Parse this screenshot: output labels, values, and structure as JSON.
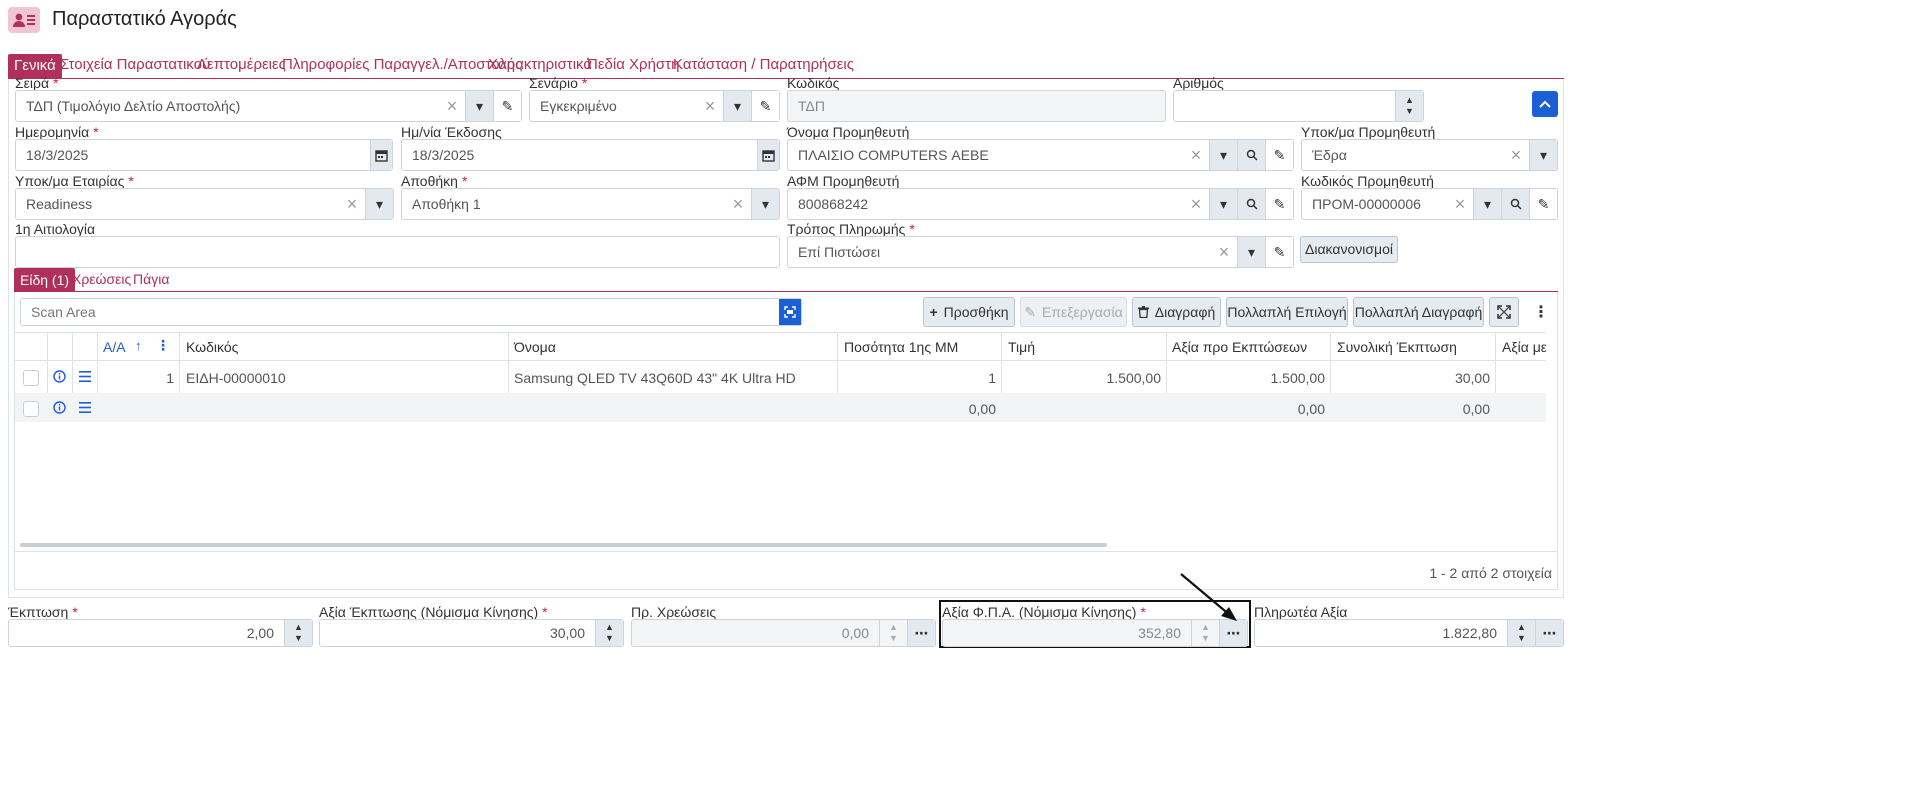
{
  "page": {
    "title": "Παραστατικό Αγοράς"
  },
  "tabs": [
    "Γενικά",
    "Στοιχεία Παραστατικού",
    "Λεπτομέρειες",
    "Πληροφορίες Παραγγελ./Αποστολής",
    "Χαρακτηριστικά",
    "Πεδία Χρήστη",
    "Κατάσταση / Παρατηρήσεις"
  ],
  "form": {
    "series": {
      "label": "Σειρά",
      "value": "ΤΔΠ (Τιμολόγιο Δελτίο Αποστολής)"
    },
    "scenario": {
      "label": "Σενάριο",
      "value": "Εγκεκριμένο"
    },
    "code": {
      "label": "Κωδικός",
      "value": "ΤΔΠ"
    },
    "number": {
      "label": "Αριθμός",
      "value": ""
    },
    "date": {
      "label": "Ημερομηνία",
      "value": "18/3/2025"
    },
    "issue_date": {
      "label": "Ημ/νία Έκδοσης",
      "value": "18/3/2025"
    },
    "supplier_name": {
      "label": "Όνομα Προμηθευτή",
      "value": "ΠΛΑΙΣΙΟ COMPUTERS ΑΕΒΕ"
    },
    "supplier_branch": {
      "label": "Υποκ/μα Προμηθευτή",
      "value": "Έδρα"
    },
    "company_branch": {
      "label": "Υποκ/μα Εταιρίας",
      "value": "Readiness"
    },
    "warehouse": {
      "label": "Αποθήκη",
      "value": "Αποθήκη 1"
    },
    "supplier_vat": {
      "label": "ΑΦΜ Προμηθευτή",
      "value": "800868242"
    },
    "supplier_code": {
      "label": "Κωδικός Προμηθευτή",
      "value": "ΠΡΟΜ-00000006"
    },
    "reason": {
      "label": "1η Αιτιολογία",
      "value": ""
    },
    "payment": {
      "label": "Τρόπος Πληρωμής",
      "value": "Επί Πιστώσει"
    },
    "settlements_label": "Διακανονισμοί",
    "required_mark": "*"
  },
  "subtabs": [
    "Είδη (1)",
    "Χρεώσεις",
    "Πάγια"
  ],
  "toolbar": {
    "scan_placeholder": "Scan Area",
    "add": "Προσθήκη",
    "edit": "Επεξεργασία",
    "delete": "Διαγραφή",
    "multi_select": "Πολλαπλή Επιλογή",
    "multi_delete": "Πολλαπλή Διαγραφή"
  },
  "grid": {
    "columns": [
      "Α/Α",
      "Κωδικός",
      "Όνομα",
      "Ποσότητα 1ης ΜΜ",
      "Τιμή",
      "Αξία προ Εκπτώσεων",
      "Συνολική Έκπτωση",
      "Αξία μετ"
    ],
    "rows": [
      {
        "aa": "1",
        "code": "ΕΙΔΗ-00000010",
        "name": "Samsung QLED TV 43Q60D 43\" 4K Ultra HD",
        "qty": "1",
        "price": "1.500,00",
        "gross": "1.500,00",
        "discount": "30,00"
      },
      {
        "aa": "",
        "code": "",
        "name": "",
        "qty": "0,00",
        "price": "",
        "gross": "0,00",
        "discount": "0,00"
      }
    ],
    "footer": "1 - 2 από 2 στοιχεία"
  },
  "totals": {
    "discount": {
      "label": "Έκπτωση",
      "value": "2,00"
    },
    "discount_value": {
      "label": "Αξία Έκπτωσης (Νόμισμα Κίνησης)",
      "value": "30,00"
    },
    "charges": {
      "label": "Πρ. Χρεώσεις",
      "value": "0,00"
    },
    "vat_value": {
      "label": "Αξία Φ.Π.Α. (Νόμισμα Κίνησης)",
      "value": "352,80"
    },
    "payable": {
      "label": "Πληρωτέα Αξία",
      "value": "1.822,80"
    }
  },
  "colors": {
    "accent": "#b0305a",
    "primary": "#1a5fd6"
  }
}
